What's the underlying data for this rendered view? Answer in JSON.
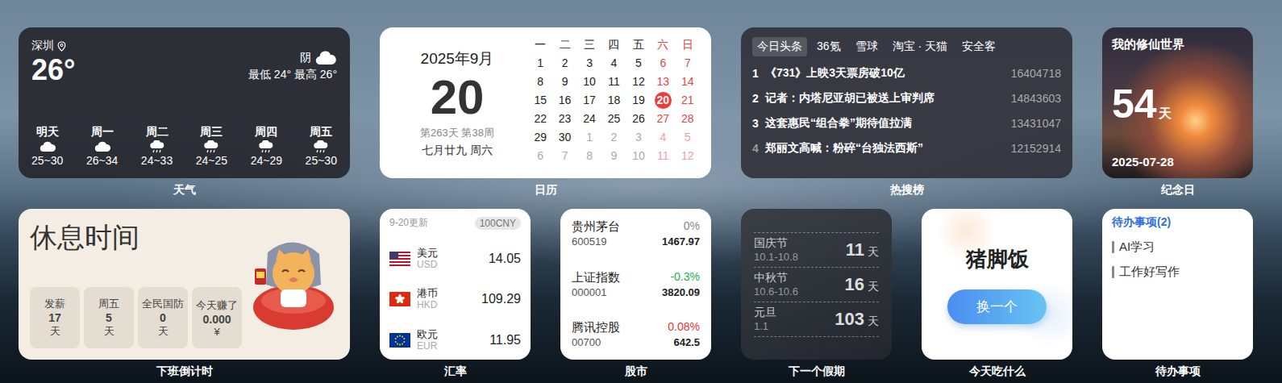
{
  "weather": {
    "label": "天气",
    "city": "深圳",
    "temp": "26°",
    "condition": "阴",
    "range": "最低 24° 最高 26°",
    "forecast": [
      {
        "day": "明天",
        "range": "25~30",
        "kind": "cloudy"
      },
      {
        "day": "周一",
        "range": "26~34",
        "kind": "cloudy"
      },
      {
        "day": "周二",
        "range": "24~33",
        "kind": "rain"
      },
      {
        "day": "周三",
        "range": "24~25",
        "kind": "rain"
      },
      {
        "day": "周四",
        "range": "24~29",
        "kind": "rain"
      },
      {
        "day": "周五",
        "range": "25~30",
        "kind": "rain"
      }
    ]
  },
  "calendar": {
    "label": "日历",
    "title": "2025年9月",
    "day": "20",
    "meta": "第263天 第38周",
    "lunar": "七月廿九 周六",
    "weekdays": [
      {
        "text": "一",
        "weekend": false
      },
      {
        "text": "二",
        "weekend": false
      },
      {
        "text": "三",
        "weekend": false
      },
      {
        "text": "四",
        "weekend": false
      },
      {
        "text": "五",
        "weekend": false
      },
      {
        "text": "六",
        "weekend": true
      },
      {
        "text": "日",
        "weekend": true
      }
    ],
    "weeks": [
      [
        {
          "d": "1",
          "cur": true,
          "selected": false
        },
        {
          "d": "2",
          "cur": true,
          "selected": false
        },
        {
          "d": "3",
          "cur": true,
          "selected": false
        },
        {
          "d": "4",
          "cur": true,
          "selected": false
        },
        {
          "d": "5",
          "cur": true,
          "selected": false
        },
        {
          "d": "6",
          "cur": true,
          "selected": false
        },
        {
          "d": "7",
          "cur": true,
          "selected": false
        }
      ],
      [
        {
          "d": "8",
          "cur": true,
          "selected": false
        },
        {
          "d": "9",
          "cur": true,
          "selected": false
        },
        {
          "d": "10",
          "cur": true,
          "selected": false
        },
        {
          "d": "11",
          "cur": true,
          "selected": false
        },
        {
          "d": "12",
          "cur": true,
          "selected": false
        },
        {
          "d": "13",
          "cur": true,
          "selected": false
        },
        {
          "d": "14",
          "cur": true,
          "selected": false
        }
      ],
      [
        {
          "d": "15",
          "cur": true,
          "selected": false
        },
        {
          "d": "16",
          "cur": true,
          "selected": false
        },
        {
          "d": "17",
          "cur": true,
          "selected": false
        },
        {
          "d": "18",
          "cur": true,
          "selected": false
        },
        {
          "d": "19",
          "cur": true,
          "selected": false
        },
        {
          "d": "20",
          "cur": true,
          "selected": true
        },
        {
          "d": "21",
          "cur": true,
          "selected": false
        }
      ],
      [
        {
          "d": "22",
          "cur": true,
          "selected": false
        },
        {
          "d": "23",
          "cur": true,
          "selected": false
        },
        {
          "d": "24",
          "cur": true,
          "selected": false
        },
        {
          "d": "25",
          "cur": true,
          "selected": false
        },
        {
          "d": "26",
          "cur": true,
          "selected": false
        },
        {
          "d": "27",
          "cur": true,
          "selected": false
        },
        {
          "d": "28",
          "cur": true,
          "selected": false
        }
      ],
      [
        {
          "d": "29",
          "cur": true,
          "selected": false
        },
        {
          "d": "30",
          "cur": true,
          "selected": false
        },
        {
          "d": "1",
          "cur": false,
          "selected": false
        },
        {
          "d": "2",
          "cur": false,
          "selected": false
        },
        {
          "d": "3",
          "cur": false,
          "selected": false
        },
        {
          "d": "4",
          "cur": false,
          "selected": false
        },
        {
          "d": "5",
          "cur": false,
          "selected": false
        }
      ],
      [
        {
          "d": "6",
          "cur": false,
          "selected": false
        },
        {
          "d": "7",
          "cur": false,
          "selected": false
        },
        {
          "d": "8",
          "cur": false,
          "selected": false
        },
        {
          "d": "9",
          "cur": false,
          "selected": false
        },
        {
          "d": "10",
          "cur": false,
          "selected": false
        },
        {
          "d": "11",
          "cur": false,
          "selected": false
        },
        {
          "d": "12",
          "cur": false,
          "selected": false
        }
      ]
    ]
  },
  "hot": {
    "label": "热搜榜",
    "tabs": [
      {
        "label": "今日头条",
        "selected": true
      },
      {
        "label": "36氪",
        "selected": false
      },
      {
        "label": "雪球",
        "selected": false
      },
      {
        "label": "淘宝 · 天猫",
        "selected": false
      },
      {
        "label": "安全客",
        "selected": false
      }
    ],
    "items": [
      {
        "rank": "1",
        "title": "《731》上映3天票房破10亿",
        "count": "16404718",
        "highlight": true
      },
      {
        "rank": "2",
        "title": "记者：内塔尼亚胡已被送上审判席",
        "count": "14843603",
        "highlight": true
      },
      {
        "rank": "3",
        "title": "这套惠民“组合拳”期待值拉满",
        "count": "13431047",
        "highlight": true
      },
      {
        "rank": "4",
        "title": "郑丽文高喊：粉碎“台独法西斯”",
        "count": "12152914",
        "highlight": false
      }
    ]
  },
  "anniversary": {
    "label": "纪念日",
    "title": "我的修仙世界",
    "count": "54",
    "unit": "天",
    "date": "2025-07-28"
  },
  "rest": {
    "label": "下班倒计时",
    "title": "休息时间",
    "stats": [
      {
        "name": "发薪",
        "value": "17",
        "unit": "天"
      },
      {
        "name": "周五",
        "value": "5",
        "unit": "天"
      },
      {
        "name": "全民国防",
        "value": "0",
        "unit": "天"
      },
      {
        "name": "今天赚了",
        "value": "0.000",
        "unit": "¥"
      }
    ]
  },
  "exchange": {
    "label": "汇率",
    "updated": "9-20更新",
    "base": "100CNY",
    "rates": [
      {
        "name": "美元",
        "code": "USD",
        "value": "14.05",
        "kind": "us"
      },
      {
        "name": "港币",
        "code": "HKD",
        "value": "109.29",
        "kind": "hk"
      },
      {
        "name": "欧元",
        "code": "EUR",
        "value": "11.95",
        "kind": "eu"
      }
    ]
  },
  "stocks": {
    "label": "股市",
    "items": [
      {
        "name": "贵州茅台",
        "code": "600519",
        "change": "0%",
        "price": "1467.97",
        "color": "#888888"
      },
      {
        "name": "上证指数",
        "code": "000001",
        "change": "-0.3%",
        "price": "3820.09",
        "color": "#22b14c"
      },
      {
        "name": "腾讯控股",
        "code": "00700",
        "change": "0.08%",
        "price": "642.5",
        "color": "#e53935"
      }
    ]
  },
  "holidays": {
    "label": "下一个假期",
    "items": [
      {
        "name": "国庆节",
        "dates": "10.1-10.8",
        "days": "11",
        "unit": "天"
      },
      {
        "name": "中秋节",
        "dates": "10.6-10.6",
        "days": "16",
        "unit": "天"
      },
      {
        "name": "元旦",
        "dates": "1.1",
        "days": "103",
        "unit": "天"
      }
    ]
  },
  "food": {
    "label": "今天吃什么",
    "dish": "猪脚饭",
    "button": "换一个"
  },
  "todo": {
    "label": "待办事项",
    "title": "待办事项(2)",
    "items": [
      "AI学习",
      "工作好写作"
    ]
  }
}
